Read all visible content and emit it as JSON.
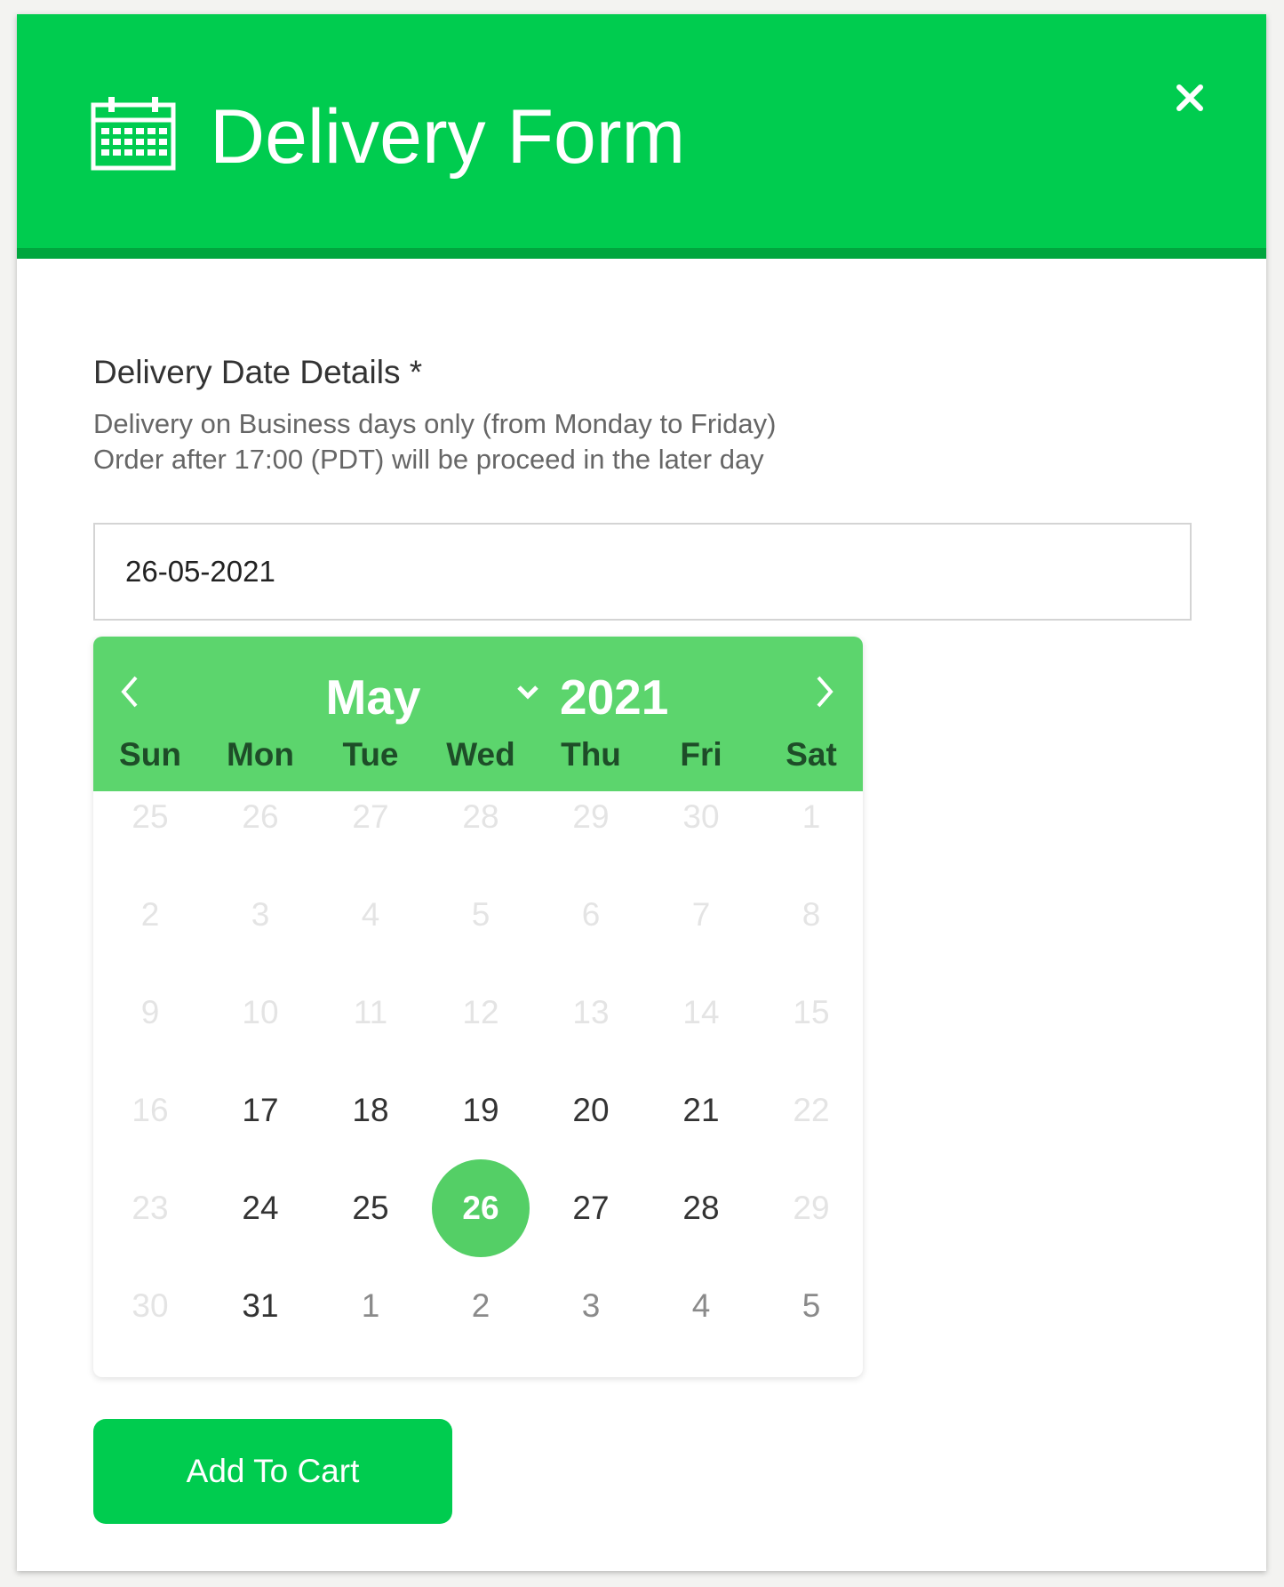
{
  "header": {
    "title": "Delivery Form",
    "icon": "calendar-icon",
    "close_icon": "close-icon"
  },
  "form": {
    "label": "Delivery Date Details *",
    "help_line1": "Delivery on Business days only (from Monday to Friday)",
    "help_line2": "Order after 17:00 (PDT) will be proceed in the later day",
    "date_value": "26-05-2021"
  },
  "calendar": {
    "month": "May",
    "year": "2021",
    "weekdays": [
      "Sun",
      "Mon",
      "Tue",
      "Wed",
      "Thu",
      "Fri",
      "Sat"
    ],
    "weeks": [
      [
        {
          "d": "25",
          "s": "muted"
        },
        {
          "d": "26",
          "s": "muted"
        },
        {
          "d": "27",
          "s": "muted"
        },
        {
          "d": "28",
          "s": "muted"
        },
        {
          "d": "29",
          "s": "muted"
        },
        {
          "d": "30",
          "s": "muted"
        },
        {
          "d": "1",
          "s": "muted"
        }
      ],
      [
        {
          "d": "2",
          "s": "muted"
        },
        {
          "d": "3",
          "s": "muted"
        },
        {
          "d": "4",
          "s": "muted"
        },
        {
          "d": "5",
          "s": "muted"
        },
        {
          "d": "6",
          "s": "muted"
        },
        {
          "d": "7",
          "s": "muted"
        },
        {
          "d": "8",
          "s": "muted"
        }
      ],
      [
        {
          "d": "9",
          "s": "muted"
        },
        {
          "d": "10",
          "s": "muted"
        },
        {
          "d": "11",
          "s": "muted"
        },
        {
          "d": "12",
          "s": "muted"
        },
        {
          "d": "13",
          "s": "muted"
        },
        {
          "d": "14",
          "s": "muted"
        },
        {
          "d": "15",
          "s": "muted"
        }
      ],
      [
        {
          "d": "16",
          "s": "muted"
        },
        {
          "d": "17",
          "s": "active"
        },
        {
          "d": "18",
          "s": "active"
        },
        {
          "d": "19",
          "s": "active"
        },
        {
          "d": "20",
          "s": "active"
        },
        {
          "d": "21",
          "s": "active"
        },
        {
          "d": "22",
          "s": "muted"
        }
      ],
      [
        {
          "d": "23",
          "s": "muted"
        },
        {
          "d": "24",
          "s": "active"
        },
        {
          "d": "25",
          "s": "active"
        },
        {
          "d": "26",
          "s": "selected"
        },
        {
          "d": "27",
          "s": "active"
        },
        {
          "d": "28",
          "s": "active"
        },
        {
          "d": "29",
          "s": "muted"
        }
      ],
      [
        {
          "d": "30",
          "s": "muted"
        },
        {
          "d": "31",
          "s": "active"
        },
        {
          "d": "1",
          "s": "next-month"
        },
        {
          "d": "2",
          "s": "next-month"
        },
        {
          "d": "3",
          "s": "next-month"
        },
        {
          "d": "4",
          "s": "next-month"
        },
        {
          "d": "5",
          "s": "next-month"
        }
      ]
    ]
  },
  "actions": {
    "add_to_cart": "Add To Cart"
  },
  "colors": {
    "header_green": "#00cc4f",
    "header_border": "#00a63e",
    "calendar_green": "#5cd56d",
    "selected_day": "#54cf66"
  }
}
